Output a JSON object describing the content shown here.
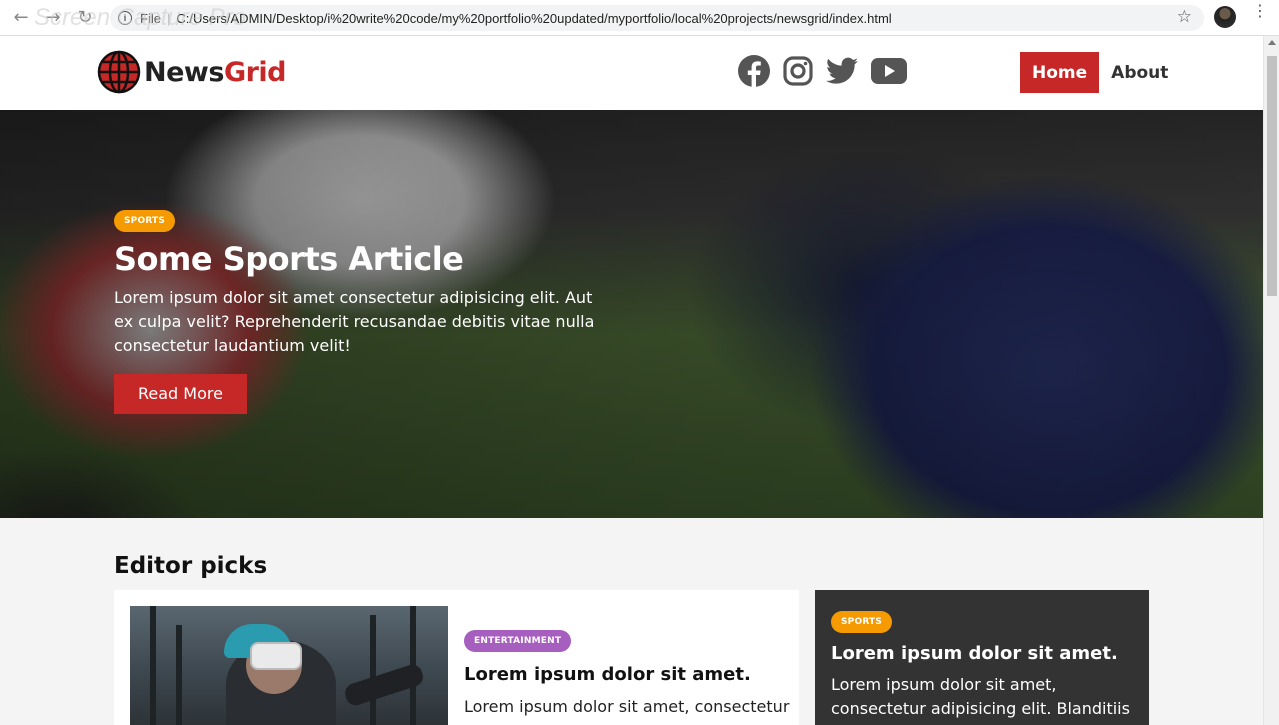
{
  "browser": {
    "file_label": "File",
    "url": "C:/Users/ADMIN/Desktop/i%20write%20code/my%20portfolio%20updated/myportfolio/local%20projects/newsgrid/index.html",
    "watermark": "Screen Capture Pro"
  },
  "header": {
    "logo_news": "News",
    "logo_grid": "Grid",
    "social": [
      "facebook-icon",
      "instagram-icon",
      "twitter-icon",
      "youtube-icon"
    ],
    "nav": {
      "home": "Home",
      "about": "About"
    }
  },
  "hero": {
    "category": "SPORTS",
    "title": "Some Sports Article",
    "text": "Lorem ipsum dolor sit amet consectetur adipisicing elit. Aut ex culpa velit? Reprehenderit recusandae debitis vitae nulla consectetur laudantium velit!",
    "button": "Read More"
  },
  "editor_picks": {
    "title": "Editor picks",
    "main_card": {
      "category": "ENTERTAINMENT",
      "title": "Lorem ipsum dolor sit amet.",
      "text": "Lorem ipsum dolor sit amet, consectetur"
    },
    "side_card": {
      "category": "SPORTS",
      "title": "Lorem ipsum dolor sit amet.",
      "text": "Lorem ipsum dolor sit amet, consectetur adipisicing elit. Blanditiis"
    }
  },
  "colors": {
    "brand_red": "#c62828",
    "sports_badge": "#f59a00",
    "entertainment_badge": "#a65fbe",
    "dark_card": "#333333"
  }
}
